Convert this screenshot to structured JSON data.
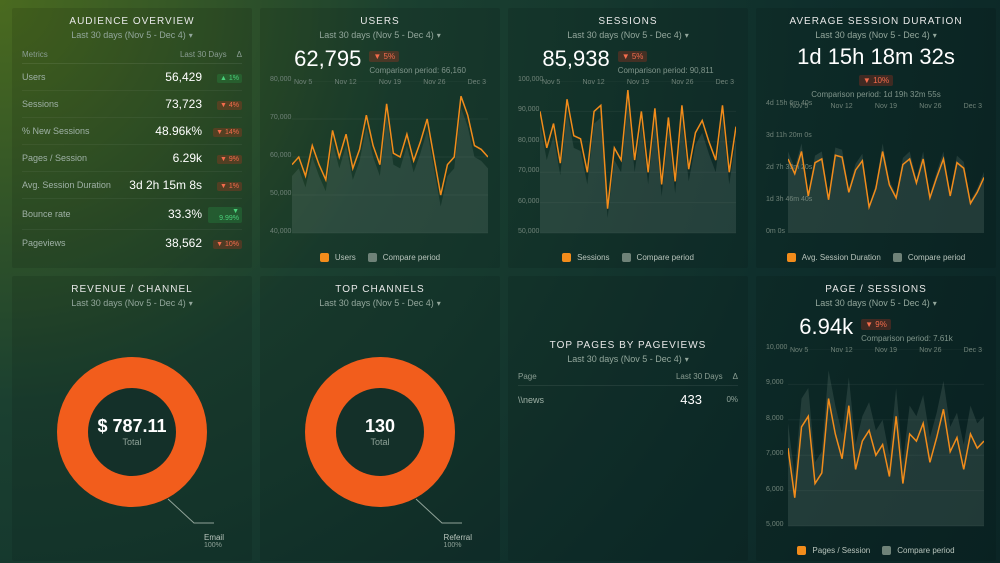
{
  "dateRange": "Last 30 days (Nov 5 - Dec 4)",
  "audience": {
    "title": "AUDIENCE OVERVIEW",
    "cols": {
      "metric": "Metrics",
      "period": "Last 30 Days",
      "delta": "Δ"
    },
    "rows": [
      {
        "label": "Users",
        "value": "56,429",
        "delta": "▲ 1%",
        "dir": "up"
      },
      {
        "label": "Sessions",
        "value": "73,723",
        "delta": "▼ 4%",
        "dir": "down"
      },
      {
        "label": "% New Sessions",
        "value": "48.96k%",
        "delta": "▼ 14%",
        "dir": "down"
      },
      {
        "label": "Pages / Session",
        "value": "6.29k",
        "delta": "▼ 9%",
        "dir": "down"
      },
      {
        "label": "Avg. Session Duration",
        "value": "3d 2h 15m 8s",
        "delta": "▼ 1%",
        "dir": "down"
      },
      {
        "label": "Bounce rate",
        "value": "33.3%",
        "delta": "▼ 9.99%",
        "dir": "up"
      },
      {
        "label": "Pageviews",
        "value": "38,562",
        "delta": "▼ 10%",
        "dir": "down"
      }
    ]
  },
  "users": {
    "title": "USERS",
    "value": "62,795",
    "delta": "▼ 5%",
    "dir": "down",
    "comp": "Comparison period: 66,160",
    "legend": "Users",
    "compare": "Compare period"
  },
  "sessions": {
    "title": "SESSIONS",
    "value": "85,938",
    "delta": "▼ 5%",
    "dir": "down",
    "comp": "Comparison period: 90,811",
    "legend": "Sessions",
    "compare": "Compare period"
  },
  "avgdur": {
    "title": "AVERAGE SESSION DURATION",
    "value": "1d 15h 18m 32s",
    "delta": "▼ 10%",
    "dir": "down",
    "comp": "Comparison period: 1d 19h 32m 55s",
    "legend": "Avg. Session Duration",
    "compare": "Compare period"
  },
  "revenue": {
    "title": "REVENUE / CHANNEL",
    "value": "$ 787.11",
    "total": "Total",
    "seg": "Email",
    "pct": "100%"
  },
  "channels": {
    "title": "TOP CHANNELS",
    "value": "130",
    "total": "Total",
    "seg": "Referral",
    "pct": "100%"
  },
  "toppages": {
    "title": "TOP PAGES BY PAGEVIEWS",
    "cols": {
      "page": "Page",
      "period": "Last 30 Days",
      "delta": "Δ"
    },
    "rows": [
      {
        "page": "\\\\news",
        "value": "433",
        "delta": "0%"
      }
    ]
  },
  "pagesess": {
    "title": "PAGE / SESSIONS",
    "value": "6.94k",
    "delta": "▼ 9%",
    "dir": "down",
    "comp": "Comparison period: 7.61k",
    "legend": "Pages / Session",
    "compare": "Compare period"
  },
  "xcats": [
    "Nov 5",
    "Nov 12",
    "Nov 19",
    "Nov 26",
    "Dec 3"
  ],
  "chart_data": [
    {
      "type": "line",
      "title": "Users",
      "xlabel": "",
      "ylabel": "",
      "ylim": [
        40000,
        80000
      ],
      "yticks": [
        40000,
        50000,
        60000,
        70000,
        80000
      ],
      "categories": [
        "Nov 5",
        "Nov 12",
        "Nov 19",
        "Nov 26",
        "Dec 3"
      ],
      "series": [
        {
          "name": "Users",
          "values": [
            58000,
            60000,
            55000,
            63000,
            58000,
            54000,
            67000,
            60000,
            66000,
            57000,
            62000,
            71000,
            63000,
            58000,
            74000,
            61000,
            60000,
            66000,
            59000,
            64000,
            70000,
            60000,
            50000,
            58000,
            60000,
            76000,
            71000,
            63000,
            62000,
            60000
          ]
        },
        {
          "name": "Compare period",
          "values": [
            55000,
            57000,
            52000,
            60000,
            55000,
            51000,
            64000,
            57000,
            63000,
            54000,
            59000,
            68000,
            60000,
            55000,
            71000,
            58000,
            57000,
            63000,
            56000,
            61000,
            67000,
            57000,
            47000,
            55000,
            57000,
            73000,
            68000,
            60000,
            59000,
            57000
          ]
        }
      ]
    },
    {
      "type": "line",
      "title": "Sessions",
      "xlabel": "",
      "ylabel": "",
      "ylim": [
        50000,
        100000
      ],
      "yticks": [
        50000,
        60000,
        70000,
        80000,
        90000,
        100000
      ],
      "categories": [
        "Nov 5",
        "Nov 12",
        "Nov 19",
        "Nov 26",
        "Dec 3"
      ],
      "series": [
        {
          "name": "Sessions",
          "values": [
            90000,
            78000,
            86000,
            73000,
            94000,
            82000,
            81000,
            70000,
            90000,
            92000,
            58000,
            78000,
            74000,
            97000,
            74000,
            90000,
            70000,
            91000,
            66000,
            88000,
            67000,
            92000,
            71000,
            83000,
            87000,
            80000,
            74000,
            92000,
            70000,
            85000
          ]
        },
        {
          "name": "Compare period",
          "values": [
            86000,
            74000,
            82000,
            69000,
            90000,
            78000,
            77000,
            66000,
            86000,
            88000,
            55000,
            74000,
            70000,
            93000,
            70000,
            86000,
            66000,
            87000,
            62000,
            84000,
            63000,
            88000,
            67000,
            79000,
            83000,
            76000,
            70000,
            88000,
            66000,
            81000
          ]
        }
      ]
    },
    {
      "type": "line",
      "title": "Average Session Duration",
      "xlabel": "",
      "ylabel": "",
      "ylim": [
        0,
        345600
      ],
      "yticks_labels": [
        "0m 0s",
        "1d 3h 46m 40s",
        "2d 7h 33m 20s",
        "3d 11h 20m 0s",
        "4d 15h 6m 40s"
      ],
      "categories": [
        "Nov 5",
        "Nov 12",
        "Nov 19",
        "Nov 26",
        "Dec 3"
      ],
      "series": [
        {
          "name": "Avg. Session Duration",
          "values": [
            200000,
            160000,
            220000,
            100000,
            190000,
            200000,
            90000,
            210000,
            205000,
            110000,
            170000,
            195000,
            70000,
            120000,
            220000,
            130000,
            95000,
            185000,
            200000,
            135000,
            200000,
            95000,
            150000,
            200000,
            100000,
            190000,
            175000,
            80000,
            110000,
            150000
          ]
        },
        {
          "name": "Compare period",
          "values": [
            220000,
            176000,
            242000,
            110000,
            209000,
            220000,
            99000,
            231000,
            225000,
            121000,
            187000,
            214000,
            77000,
            132000,
            242000,
            143000,
            104000,
            203000,
            220000,
            148000,
            220000,
            104000,
            165000,
            220000,
            110000,
            209000,
            192000,
            88000,
            121000,
            165000
          ]
        }
      ]
    },
    {
      "type": "pie",
      "title": "Revenue / Channel",
      "series": [
        {
          "name": "Email",
          "value": 787.11,
          "pct": 100
        }
      ],
      "total": 787.11
    },
    {
      "type": "pie",
      "title": "Top Channels",
      "series": [
        {
          "name": "Referral",
          "value": 130,
          "pct": 100
        }
      ],
      "total": 130
    },
    {
      "type": "table",
      "title": "Top Pages by Pageviews",
      "columns": [
        "Page",
        "Last 30 Days",
        "Δ"
      ],
      "rows": [
        [
          "\\\\news",
          433,
          "0%"
        ]
      ]
    },
    {
      "type": "line",
      "title": "Pages / Session",
      "xlabel": "",
      "ylabel": "",
      "ylim": [
        5000,
        10000
      ],
      "yticks": [
        5000,
        6000,
        7000,
        8000,
        9000,
        10000
      ],
      "categories": [
        "Nov 5",
        "Nov 12",
        "Nov 19",
        "Nov 26",
        "Dec 3"
      ],
      "series": [
        {
          "name": "Pages / Session",
          "values": [
            7200,
            5800,
            7800,
            8100,
            6200,
            6500,
            8600,
            7600,
            6900,
            8400,
            6600,
            7400,
            7700,
            7000,
            7300,
            6400,
            8100,
            6200,
            7600,
            7400,
            7900,
            6800,
            7500,
            8300,
            7100,
            7500,
            6600,
            7600,
            7200,
            7400
          ]
        },
        {
          "name": "Compare period",
          "values": [
            7900,
            6400,
            8600,
            8900,
            6800,
            7100,
            9400,
            8400,
            7600,
            9200,
            7300,
            8100,
            8500,
            7700,
            8000,
            7000,
            8900,
            6800,
            8400,
            8100,
            8700,
            7500,
            8200,
            9100,
            7800,
            8200,
            7300,
            8400,
            7900,
            8100
          ]
        }
      ]
    }
  ]
}
